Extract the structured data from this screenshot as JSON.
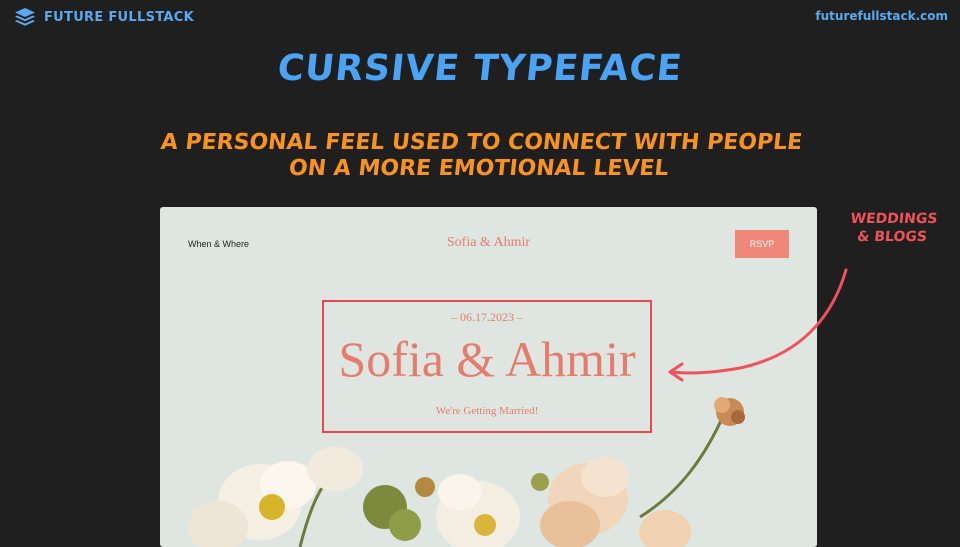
{
  "header": {
    "brand_name": "FUTURE FULLSTACK",
    "brand_icon": "stack-layers-icon",
    "site_url": "futurefullstack.com"
  },
  "slide": {
    "title": "CURSIVE TYPEFACE",
    "subtitle_line1": "A PERSONAL FEEL USED TO CONNECT WITH PEOPLE",
    "subtitle_line2": "ON A MORE EMOTIONAL LEVEL",
    "annotation_line1": "WEDDINGS",
    "annotation_line2": "& BLOGS"
  },
  "mockup": {
    "nav_left": "When & Where",
    "nav_center": "Sofia & Ahmir",
    "rsvp_label": "RSVP",
    "date": "– 06.17.2023 –",
    "names": "Sofia & Ahmir",
    "tagline": "We're Getting Married!"
  },
  "colors": {
    "background": "#1f1f1f",
    "brand_blue": "#4aa3f4",
    "subtitle_orange": "#f7931e",
    "annotation_red": "#f0525a",
    "mockup_bg": "#dfe6e2",
    "mockup_accent": "#e57c6c",
    "rsvp_bg": "#ef8878"
  }
}
